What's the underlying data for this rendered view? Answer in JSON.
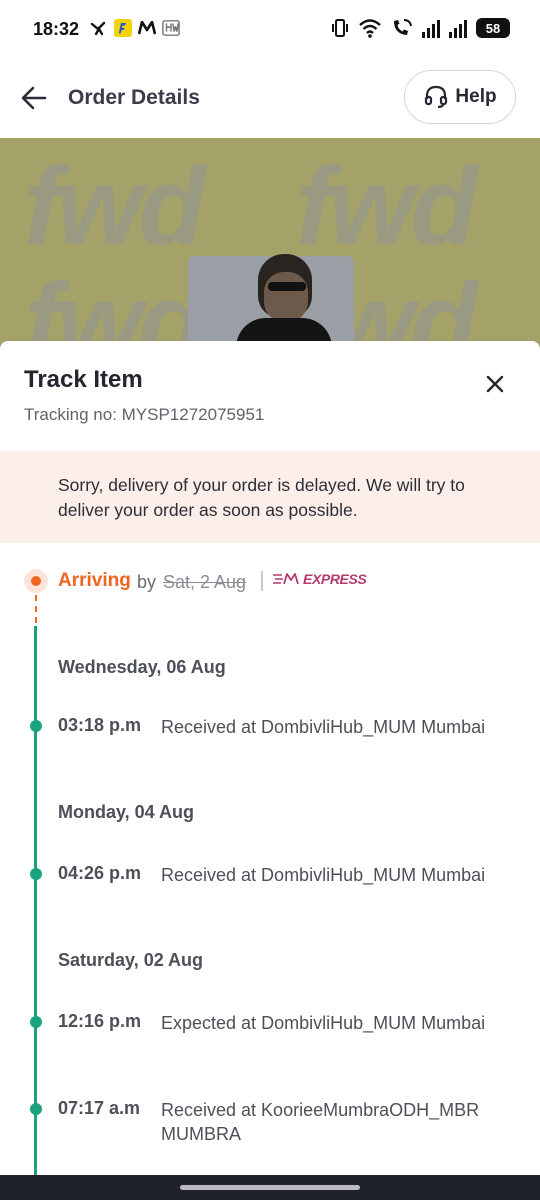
{
  "status_bar": {
    "time": "18:32",
    "app_icons": [
      "swiggy-icon",
      "flipkart-icon",
      "myntra-icon",
      "hyper-icon"
    ],
    "battery": "58"
  },
  "header": {
    "title": "Order Details",
    "help_label": "Help"
  },
  "product_banner": {
    "brand_text": "fwd"
  },
  "sheet": {
    "title": "Track Item",
    "tracking": "Tracking no: MYSP1272075951",
    "delay_message": "Sorry, delivery of your order is delayed. We will try to deliver your order as soon as possible."
  },
  "arrival": {
    "status": "Arriving",
    "by": "by",
    "date": "Sat, 2 Aug",
    "badge": "EXPRESS"
  },
  "timeline": {
    "days": [
      {
        "label": "Wednesday, 06 Aug",
        "events": [
          {
            "time": "03:18 p.m",
            "desc": "Received at DombivliHub_MUM Mumbai"
          }
        ]
      },
      {
        "label": "Monday, 04 Aug",
        "events": [
          {
            "time": "04:26 p.m",
            "desc": "Received at DombivliHub_MUM Mumbai"
          }
        ]
      },
      {
        "label": "Saturday, 02 Aug",
        "events": [
          {
            "time": "12:16 p.m",
            "desc": "Expected at DombivliHub_MUM Mumbai"
          },
          {
            "time": "07:17 a.m",
            "desc": "Received at KoorieeMumbraODH_MBR MUMBRA"
          }
        ]
      }
    ]
  },
  "colors": {
    "accent_orange": "#f16422",
    "timeline_green": "#1aa27e",
    "delay_bg": "#fcefe9",
    "express_pink": "#b53b6d"
  }
}
